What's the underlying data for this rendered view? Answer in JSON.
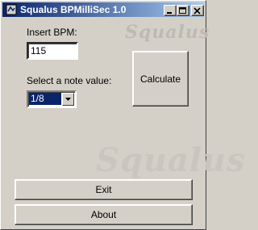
{
  "window": {
    "title": "Squalus BPMilliSec 1.0",
    "titlebar_color": "#0a246a",
    "face_color": "#d4d0c8",
    "controls": {
      "minimize": "minimize-icon",
      "maximize": "maximize-icon",
      "close": "close-icon"
    }
  },
  "form": {
    "bpm_label": "Insert BPM:",
    "bpm_value": "115",
    "note_label": "Select a note value:",
    "note_value": "1/8"
  },
  "buttons": {
    "calculate": "Calculate",
    "exit": "Exit",
    "about": "About"
  },
  "branding": {
    "logo_text": "Squalus"
  }
}
